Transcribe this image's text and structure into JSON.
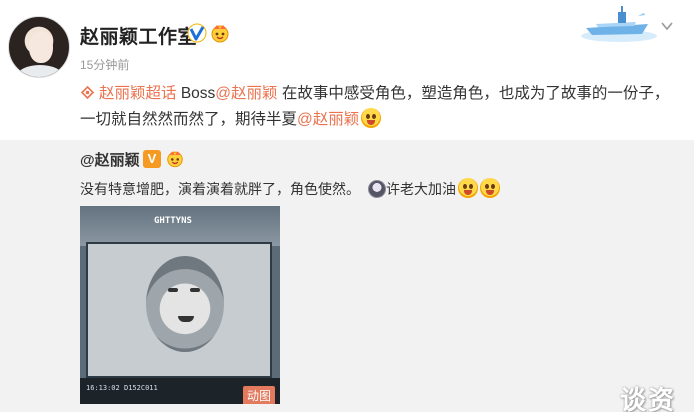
{
  "user": {
    "name": "赵丽颖工作室",
    "time": "15分钟前"
  },
  "content": {
    "supertopic": "赵丽颖超话",
    "part1": " Boss",
    "mention1": "@赵丽颖",
    "part2": " 在故事中感受角色，塑造角色，也成为了故事的一份子，一切就自然然而然了，期待半夏",
    "mention2": "@赵丽颖"
  },
  "repost": {
    "user": "@赵丽颖",
    "v_badge": "V",
    "text": "没有特意增肥，演着演着就胖了，角色使然。",
    "tail": "许老大加油"
  },
  "video": {
    "camera_label": "GHTTYNS",
    "timecode": "16:13:02",
    "clip": "D152C011",
    "gif_label": "动图"
  },
  "watermark": "谈资",
  "colors": {
    "link": "#eb7350",
    "verified": "#ffae00",
    "badge": "#f59a23"
  }
}
